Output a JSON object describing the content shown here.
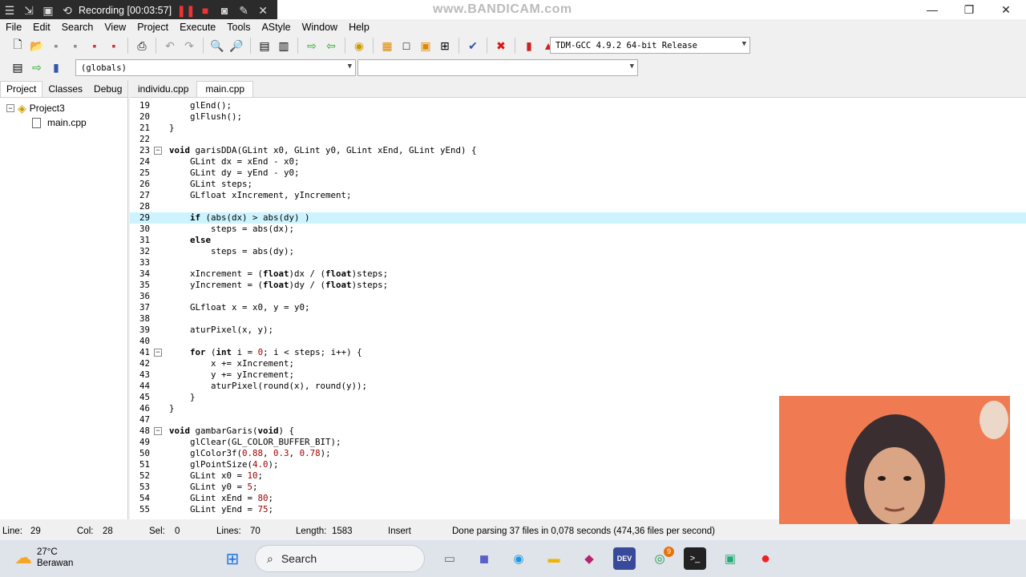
{
  "recorder": {
    "title": "Recording [00:03:57]",
    "watermark": "www.BANDICAM.com"
  },
  "menu": [
    "File",
    "Edit",
    "Search",
    "View",
    "Project",
    "Execute",
    "Tools",
    "AStyle",
    "Window",
    "Help"
  ],
  "compiler": "TDM-GCC 4.9.2 64-bit Release",
  "scope": "(globals)",
  "left_tabs": [
    "Project",
    "Classes",
    "Debug"
  ],
  "tree": {
    "project": "Project3",
    "file": "main.cpp"
  },
  "editor_tabs": [
    "individu.cpp",
    "main.cpp"
  ],
  "code": [
    {
      "n": "19",
      "t": "    glEnd();"
    },
    {
      "n": "20",
      "t": "    glFlush();"
    },
    {
      "n": "21",
      "t": "}"
    },
    {
      "n": "22",
      "t": ""
    },
    {
      "n": "23",
      "t": "void garisDDA(GLint x0, GLint y0, GLint xEnd, GLint yEnd) {"
    },
    {
      "n": "24",
      "t": "    GLint dx = xEnd - x0;"
    },
    {
      "n": "25",
      "t": "    GLint dy = yEnd - y0;"
    },
    {
      "n": "26",
      "t": "    GLint steps;"
    },
    {
      "n": "27",
      "t": "    GLfloat xIncrement, yIncrement;"
    },
    {
      "n": "28",
      "t": ""
    },
    {
      "n": "29",
      "t": "    if (abs(dx) > abs(dy) )"
    },
    {
      "n": "30",
      "t": "        steps = abs(dx);"
    },
    {
      "n": "31",
      "t": "    else"
    },
    {
      "n": "32",
      "t": "        steps = abs(dy);"
    },
    {
      "n": "33",
      "t": ""
    },
    {
      "n": "34",
      "t": "    xIncrement = (float)dx / (float)steps;"
    },
    {
      "n": "35",
      "t": "    yIncrement = (float)dy / (float)steps;"
    },
    {
      "n": "36",
      "t": ""
    },
    {
      "n": "37",
      "t": "    GLfloat x = x0, y = y0;"
    },
    {
      "n": "38",
      "t": ""
    },
    {
      "n": "39",
      "t": "    aturPixel(x, y);"
    },
    {
      "n": "40",
      "t": ""
    },
    {
      "n": "41",
      "t": "    for (int i = 0; i < steps; i++) {"
    },
    {
      "n": "42",
      "t": "        x += xIncrement;"
    },
    {
      "n": "43",
      "t": "        y += yIncrement;"
    },
    {
      "n": "44",
      "t": "        aturPixel(round(x), round(y));"
    },
    {
      "n": "45",
      "t": "    }"
    },
    {
      "n": "46",
      "t": "}"
    },
    {
      "n": "47",
      "t": ""
    },
    {
      "n": "48",
      "t": "void gambarGaris(void) {"
    },
    {
      "n": "49",
      "t": "    glClear(GL_COLOR_BUFFER_BIT);"
    },
    {
      "n": "50",
      "t": "    glColor3f(0.88, 0.3, 0.78);"
    },
    {
      "n": "51",
      "t": "    glPointSize(4.0);"
    },
    {
      "n": "52",
      "t": "    GLint x0 = 10;"
    },
    {
      "n": "53",
      "t": "    GLint y0 = 5;"
    },
    {
      "n": "54",
      "t": "    GLint xEnd = 80;"
    },
    {
      "n": "55",
      "t": "    GLint yEnd = 75;"
    }
  ],
  "status": {
    "line_label": "Line:",
    "line": "29",
    "col_label": "Col:",
    "col": "28",
    "sel_label": "Sel:",
    "sel": "0",
    "lines_label": "Lines:",
    "lines": "70",
    "length_label": "Length:",
    "length": "1583",
    "mode": "Insert",
    "message": "Done parsing 37 files in 0,078 seconds (474,36 files per second)"
  },
  "taskbar": {
    "temp": "27°C",
    "weather": "Berawan",
    "search": "Search",
    "chrome_badge": "9"
  }
}
